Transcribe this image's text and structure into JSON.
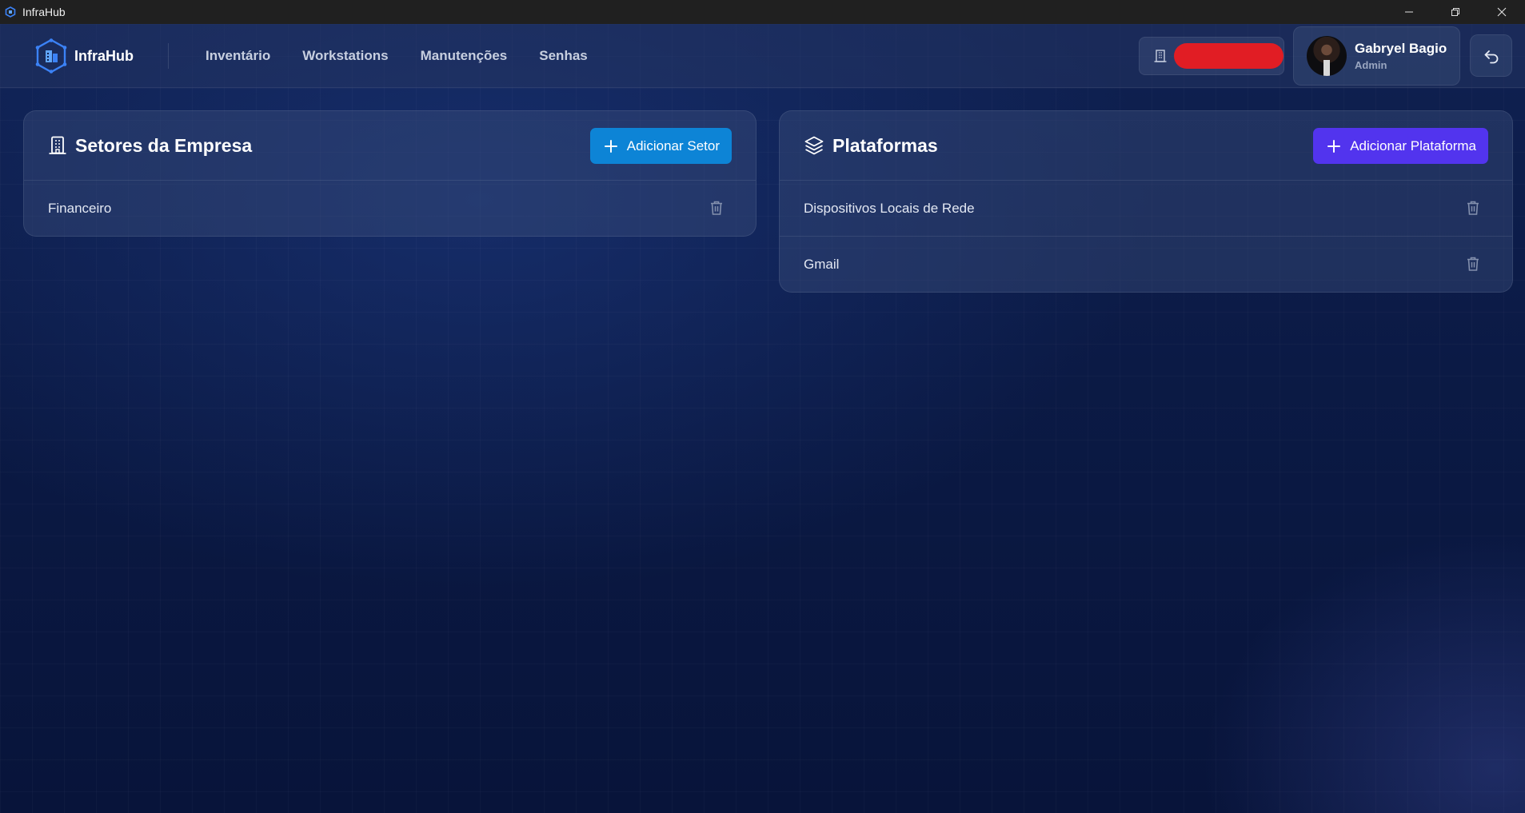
{
  "window": {
    "title": "InfraHub"
  },
  "header": {
    "brand": "InfraHub",
    "nav": [
      "Inventário",
      "Workstations",
      "Manutenções",
      "Senhas"
    ],
    "company_name": "",
    "user": {
      "name": "Gabryel Bagio",
      "role": "Admin"
    }
  },
  "sectors": {
    "title": "Setores da Empresa",
    "add_label": "Adicionar Setor",
    "items": [
      "Financeiro"
    ]
  },
  "platforms": {
    "title": "Plataformas",
    "add_label": "Adicionar Plataforma",
    "items": [
      "Dispositivos Locais de Rede",
      "Gmail"
    ]
  },
  "colors": {
    "accent_blue": "#0d84d6",
    "accent_purple": "#5234ee",
    "redaction": "#e11d24"
  }
}
